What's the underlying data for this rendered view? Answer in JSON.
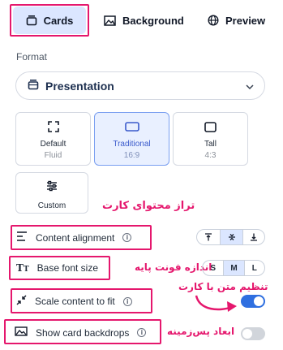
{
  "tabs": [
    {
      "label": "Cards",
      "icon": "cards-icon"
    },
    {
      "label": "Background",
      "icon": "image-icon"
    },
    {
      "label": "Preview",
      "icon": "globe-icon"
    }
  ],
  "format": {
    "label": "Format",
    "selected": "Presentation"
  },
  "aspect_options": [
    {
      "name": "Default",
      "sub": "Fluid"
    },
    {
      "name": "Traditional",
      "sub": "16:9"
    },
    {
      "name": "Tall",
      "sub": "4:3"
    },
    {
      "name": "Custom"
    }
  ],
  "settings": {
    "content_alignment": {
      "label": "Content alignment"
    },
    "base_font_size": {
      "label": "Base font size",
      "options": [
        "S",
        "M",
        "L"
      ],
      "selected": "M"
    },
    "scale_content": {
      "label": "Scale content to fit",
      "enabled": true
    },
    "card_backdrops": {
      "label": "Show card backdrops",
      "enabled": false
    }
  },
  "annotations": {
    "content_level": "تراز محتوای کارت",
    "font_size": "اندازه فونت پایه",
    "scale_text": "تنظیم متن با کارت",
    "backdrop_dims": "ابعاد پس‌زمینه"
  },
  "colors": {
    "accent": "#2f6fe0",
    "highlight": "#e5176d",
    "selected_bg": "#dbe6ff"
  }
}
